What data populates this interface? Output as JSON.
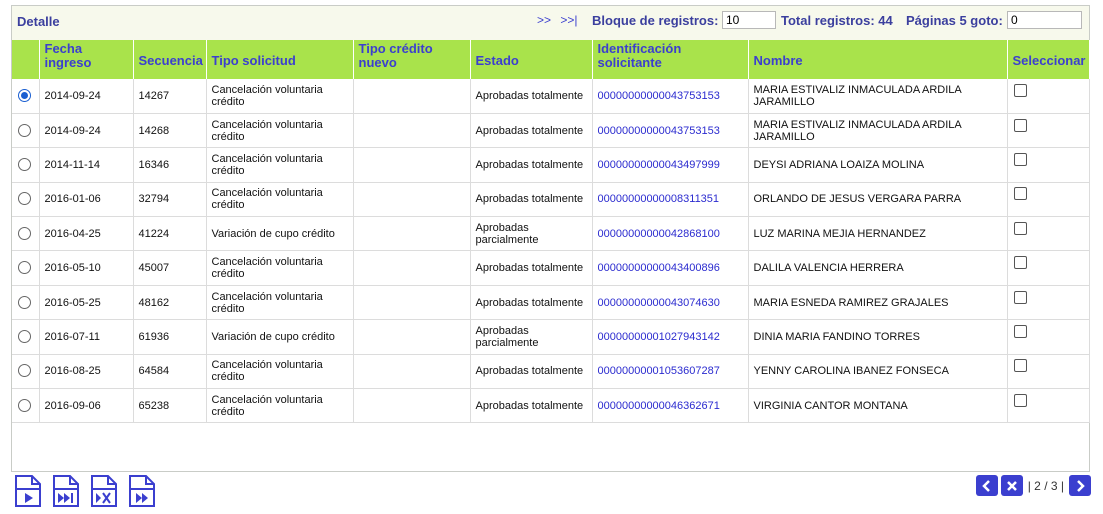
{
  "header": {
    "title": "Detalle",
    "nav_next": ">>",
    "nav_last": ">>|",
    "block_label": "Bloque de registros:",
    "block_value": "10",
    "total_label": "Total registros: 44",
    "pages_label": "Páginas 5 goto:",
    "goto_value": "0"
  },
  "columns": [
    "",
    "Fecha ingreso",
    "Secuencia",
    "Tipo solicitud",
    "Tipo crédito nuevo",
    "Estado",
    "Identificación solicitante",
    "Nombre",
    "Seleccionar"
  ],
  "rows": [
    {
      "selected": true,
      "fecha": "2014-09-24",
      "secuencia": "14267",
      "tipo": "Cancelación voluntaria crédito",
      "tipo_credito": "",
      "estado": "Aprobadas totalmente",
      "ident": "00000000000043753153",
      "nombre": "MARIA ESTIVALIZ INMACULADA ARDILA JARAMILLO"
    },
    {
      "selected": false,
      "fecha": "2014-09-24",
      "secuencia": "14268",
      "tipo": "Cancelación voluntaria crédito",
      "tipo_credito": "",
      "estado": "Aprobadas totalmente",
      "ident": "00000000000043753153",
      "nombre": "MARIA ESTIVALIZ INMACULADA ARDILA JARAMILLO"
    },
    {
      "selected": false,
      "fecha": "2014-11-14",
      "secuencia": "16346",
      "tipo": "Cancelación voluntaria crédito",
      "tipo_credito": "",
      "estado": "Aprobadas totalmente",
      "ident": "00000000000043497999",
      "nombre": "DEYSI ADRIANA LOAIZA MOLINA"
    },
    {
      "selected": false,
      "fecha": "2016-01-06",
      "secuencia": "32794",
      "tipo": "Cancelación voluntaria crédito",
      "tipo_credito": "",
      "estado": "Aprobadas totalmente",
      "ident": "00000000000008311351",
      "nombre": "ORLANDO DE JESUS VERGARA PARRA"
    },
    {
      "selected": false,
      "fecha": "2016-04-25",
      "secuencia": "41224",
      "tipo": "Variación de cupo crédito",
      "tipo_credito": "",
      "estado": "Aprobadas parcialmente",
      "ident": "00000000000042868100",
      "nombre": "LUZ MARINA MEJIA HERNANDEZ"
    },
    {
      "selected": false,
      "fecha": "2016-05-10",
      "secuencia": "45007",
      "tipo": "Cancelación voluntaria crédito",
      "tipo_credito": "",
      "estado": "Aprobadas totalmente",
      "ident": "00000000000043400896",
      "nombre": "DALILA VALENCIA HERRERA"
    },
    {
      "selected": false,
      "fecha": "2016-05-25",
      "secuencia": "48162",
      "tipo": "Cancelación voluntaria crédito",
      "tipo_credito": "",
      "estado": "Aprobadas totalmente",
      "ident": "00000000000043074630",
      "nombre": "MARIA ESNEDA RAMIREZ GRAJALES"
    },
    {
      "selected": false,
      "fecha": "2016-07-11",
      "secuencia": "61936",
      "tipo": "Variación de cupo crédito",
      "tipo_credito": "",
      "estado": "Aprobadas parcialmente",
      "ident": "00000000001027943142",
      "nombre": "DINIA MARIA FANDINO TORRES"
    },
    {
      "selected": false,
      "fecha": "2016-08-25",
      "secuencia": "64584",
      "tipo": "Cancelación voluntaria crédito",
      "tipo_credito": "",
      "estado": "Aprobadas totalmente",
      "ident": "00000000001053607287",
      "nombre": "YENNY CAROLINA IBANEZ FONSECA"
    },
    {
      "selected": false,
      "fecha": "2016-09-06",
      "secuencia": "65238",
      "tipo": "Cancelación voluntaria crédito",
      "tipo_credito": "",
      "estado": "Aprobadas totalmente",
      "ident": "00000000000046362671",
      "nombre": "VIRGINIA CANTOR MONTANA"
    }
  ],
  "pager": {
    "text": "| 2 / 3 |",
    "prev_icon": "chevron-left-icon",
    "close_icon": "close-icon",
    "next_icon": "chevron-right-icon"
  },
  "icons": [
    "document-play-icon",
    "document-fast-forward-icon",
    "document-cancel-icon",
    "document-forward-icon"
  ],
  "colors": {
    "header_bg": "#a9e34b",
    "accent": "#3b3fcf",
    "topbar_bg": "#f7f9ec"
  }
}
